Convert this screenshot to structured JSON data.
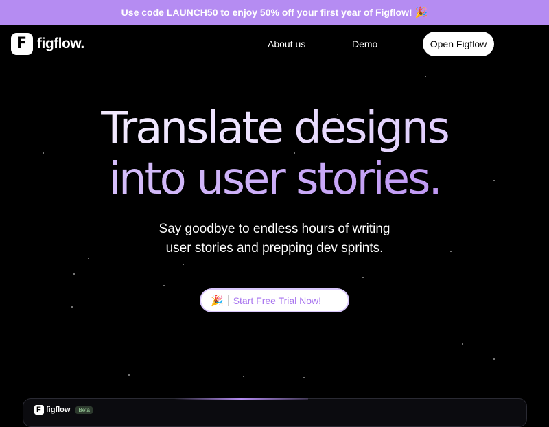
{
  "promo": {
    "text": "Use code LAUNCH50 to enjoy 50% off your first year of Figflow!",
    "emoji": "🎉"
  },
  "nav": {
    "logo_text": "figflow.",
    "logo_icon": "figflow-logo-icon",
    "links": [
      {
        "label": "About us"
      },
      {
        "label": "Demo"
      }
    ],
    "cta_label": "Open Figflow"
  },
  "hero": {
    "line1": "Translate designs",
    "line2": "into user stories.",
    "subtitle_line1": "Say goodbye to endless hours of writing",
    "subtitle_line2": "user stories and prepping dev sprints.",
    "cta_emoji": "🎉",
    "cta_label": "Start Free Trial Now!"
  },
  "preview": {
    "logo_text": "figflow",
    "badge": "Beta"
  },
  "colors": {
    "promo_bg": "#b58cf2",
    "accent": "#a875ef",
    "background": "#000000"
  }
}
